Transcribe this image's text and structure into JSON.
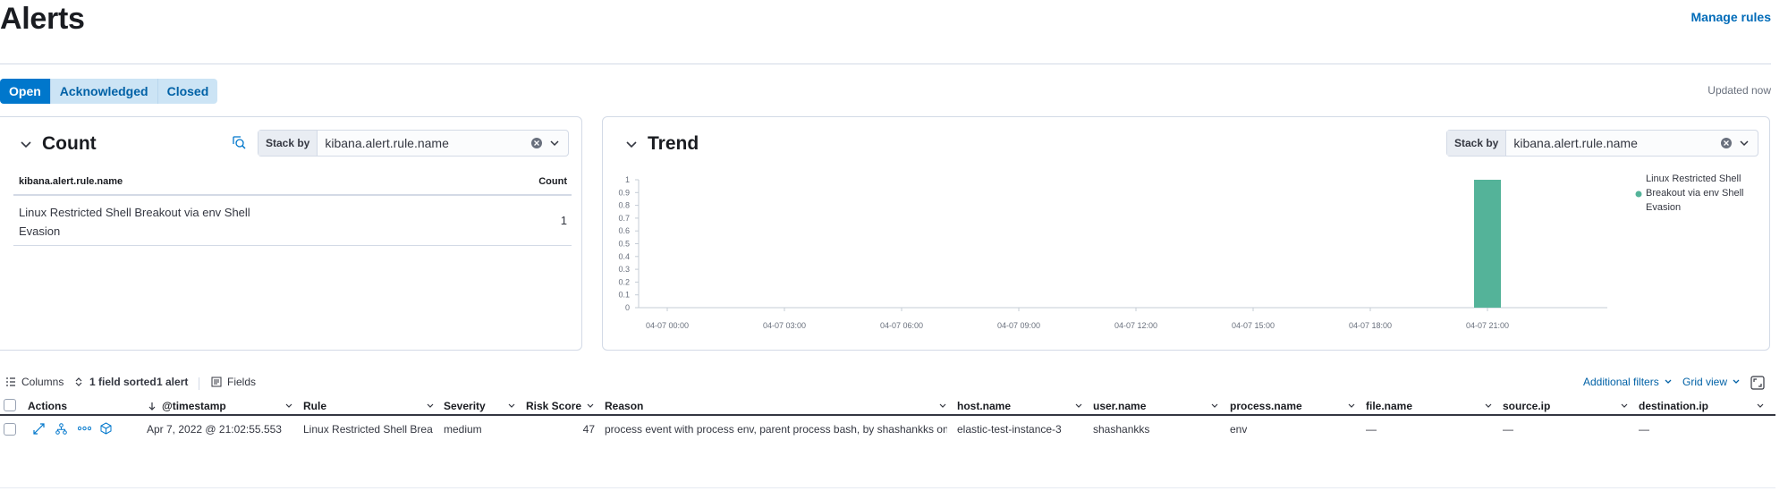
{
  "header": {
    "title": "Alerts",
    "manage_rules": "Manage rules",
    "updated": "Updated now"
  },
  "status_tabs": [
    "Open",
    "Acknowledged",
    "Closed"
  ],
  "count_panel": {
    "title": "Count",
    "stack_by_label": "Stack by",
    "stack_by_value": "kibana.alert.rule.name",
    "col_name": "kibana.alert.rule.name",
    "col_count": "Count",
    "rows": [
      {
        "name": "Linux Restricted Shell Breakout via env Shell Evasion",
        "count": "1"
      }
    ]
  },
  "trend_panel": {
    "title": "Trend",
    "stack_by_label": "Stack by",
    "stack_by_value": "kibana.alert.rule.name"
  },
  "chart_data": {
    "type": "bar",
    "x_ticks": [
      "04-07 00:00",
      "04-07 03:00",
      "04-07 06:00",
      "04-07 09:00",
      "04-07 12:00",
      "04-07 15:00",
      "04-07 18:00",
      "04-07 21:00"
    ],
    "y_ticks": [
      "0",
      "0.1",
      "0.2",
      "0.3",
      "0.4",
      "0.5",
      "0.6",
      "0.7",
      "0.8",
      "0.9",
      "1"
    ],
    "ylim": [
      0,
      1
    ],
    "series": [
      {
        "name": "Linux Restricted Shell Breakout via env Shell Evasion",
        "color": "#54b399",
        "points": [
          {
            "x": "04-07 21:00",
            "y": 1
          }
        ]
      }
    ],
    "legend": "right",
    "grid": false
  },
  "toolbar": {
    "columns": "Columns",
    "sorted": "1 field sorted",
    "alerts": "1 alert",
    "fields": "Fields",
    "additional_filters": "Additional filters",
    "grid_view": "Grid view"
  },
  "grid": {
    "columns": [
      "Actions",
      "@timestamp",
      "Rule",
      "Severity",
      "Risk Score",
      "Reason",
      "host.name",
      "user.name",
      "process.name",
      "file.name",
      "source.ip",
      "destination.ip"
    ],
    "row": {
      "timestamp": "Apr 7, 2022 @ 21:02:55.553",
      "rule": "Linux Restricted Shell Brea...",
      "severity": "medium",
      "risk_score": "47",
      "reason": "process event with process env, parent process bash, by shashankks on el...",
      "host_name": "elastic-test-instance-3",
      "user_name": "shashankks",
      "process_name": "env",
      "file_name": "—",
      "source_ip": "—",
      "destination_ip": "—"
    }
  },
  "colors": {
    "accent": "#0077cc",
    "bar": "#54b399"
  }
}
